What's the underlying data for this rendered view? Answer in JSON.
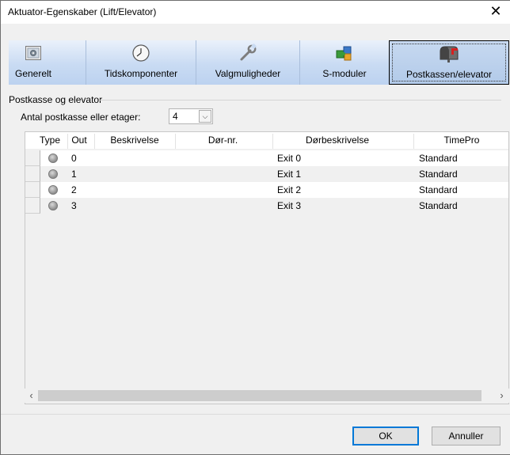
{
  "window": {
    "title": "Aktuator-Egenskaber (Lift/Elevator)",
    "close_glyph": "✕"
  },
  "toolbar": {
    "items": [
      {
        "label": "Generelt",
        "icon": "settings-panel-icon"
      },
      {
        "label": "Tidskomponenter",
        "icon": "clock-icon"
      },
      {
        "label": "Valgmuligheder",
        "icon": "wrench-icon"
      },
      {
        "label": "S-moduler",
        "icon": "puzzle-icon"
      },
      {
        "label": "Postkassen/elevator",
        "icon": "mailbox-icon",
        "active": true
      }
    ]
  },
  "group": {
    "label": "Postkasse og elevator",
    "count_label": "Antal postkasse eller etager:",
    "count_value": "4"
  },
  "grid": {
    "columns": [
      "Type",
      "Out",
      "Beskrivelse",
      "Dør-nr.",
      "Dørbeskrivelse",
      "TimePro"
    ],
    "rows": [
      {
        "out": "0",
        "description": "",
        "door": "",
        "door_desc": "Exit 0",
        "timepro": "Standard"
      },
      {
        "out": "1",
        "description": "",
        "door": "",
        "door_desc": "Exit 1",
        "timepro": "Standard"
      },
      {
        "out": "2",
        "description": "",
        "door": "",
        "door_desc": "Exit 2",
        "timepro": "Standard"
      },
      {
        "out": "3",
        "description": "",
        "door": "",
        "door_desc": "Exit 3",
        "timepro": "Standard"
      }
    ],
    "scroll_left": "‹",
    "scroll_right": "›"
  },
  "buttons": {
    "ok": "OK",
    "cancel": "Annuller"
  }
}
